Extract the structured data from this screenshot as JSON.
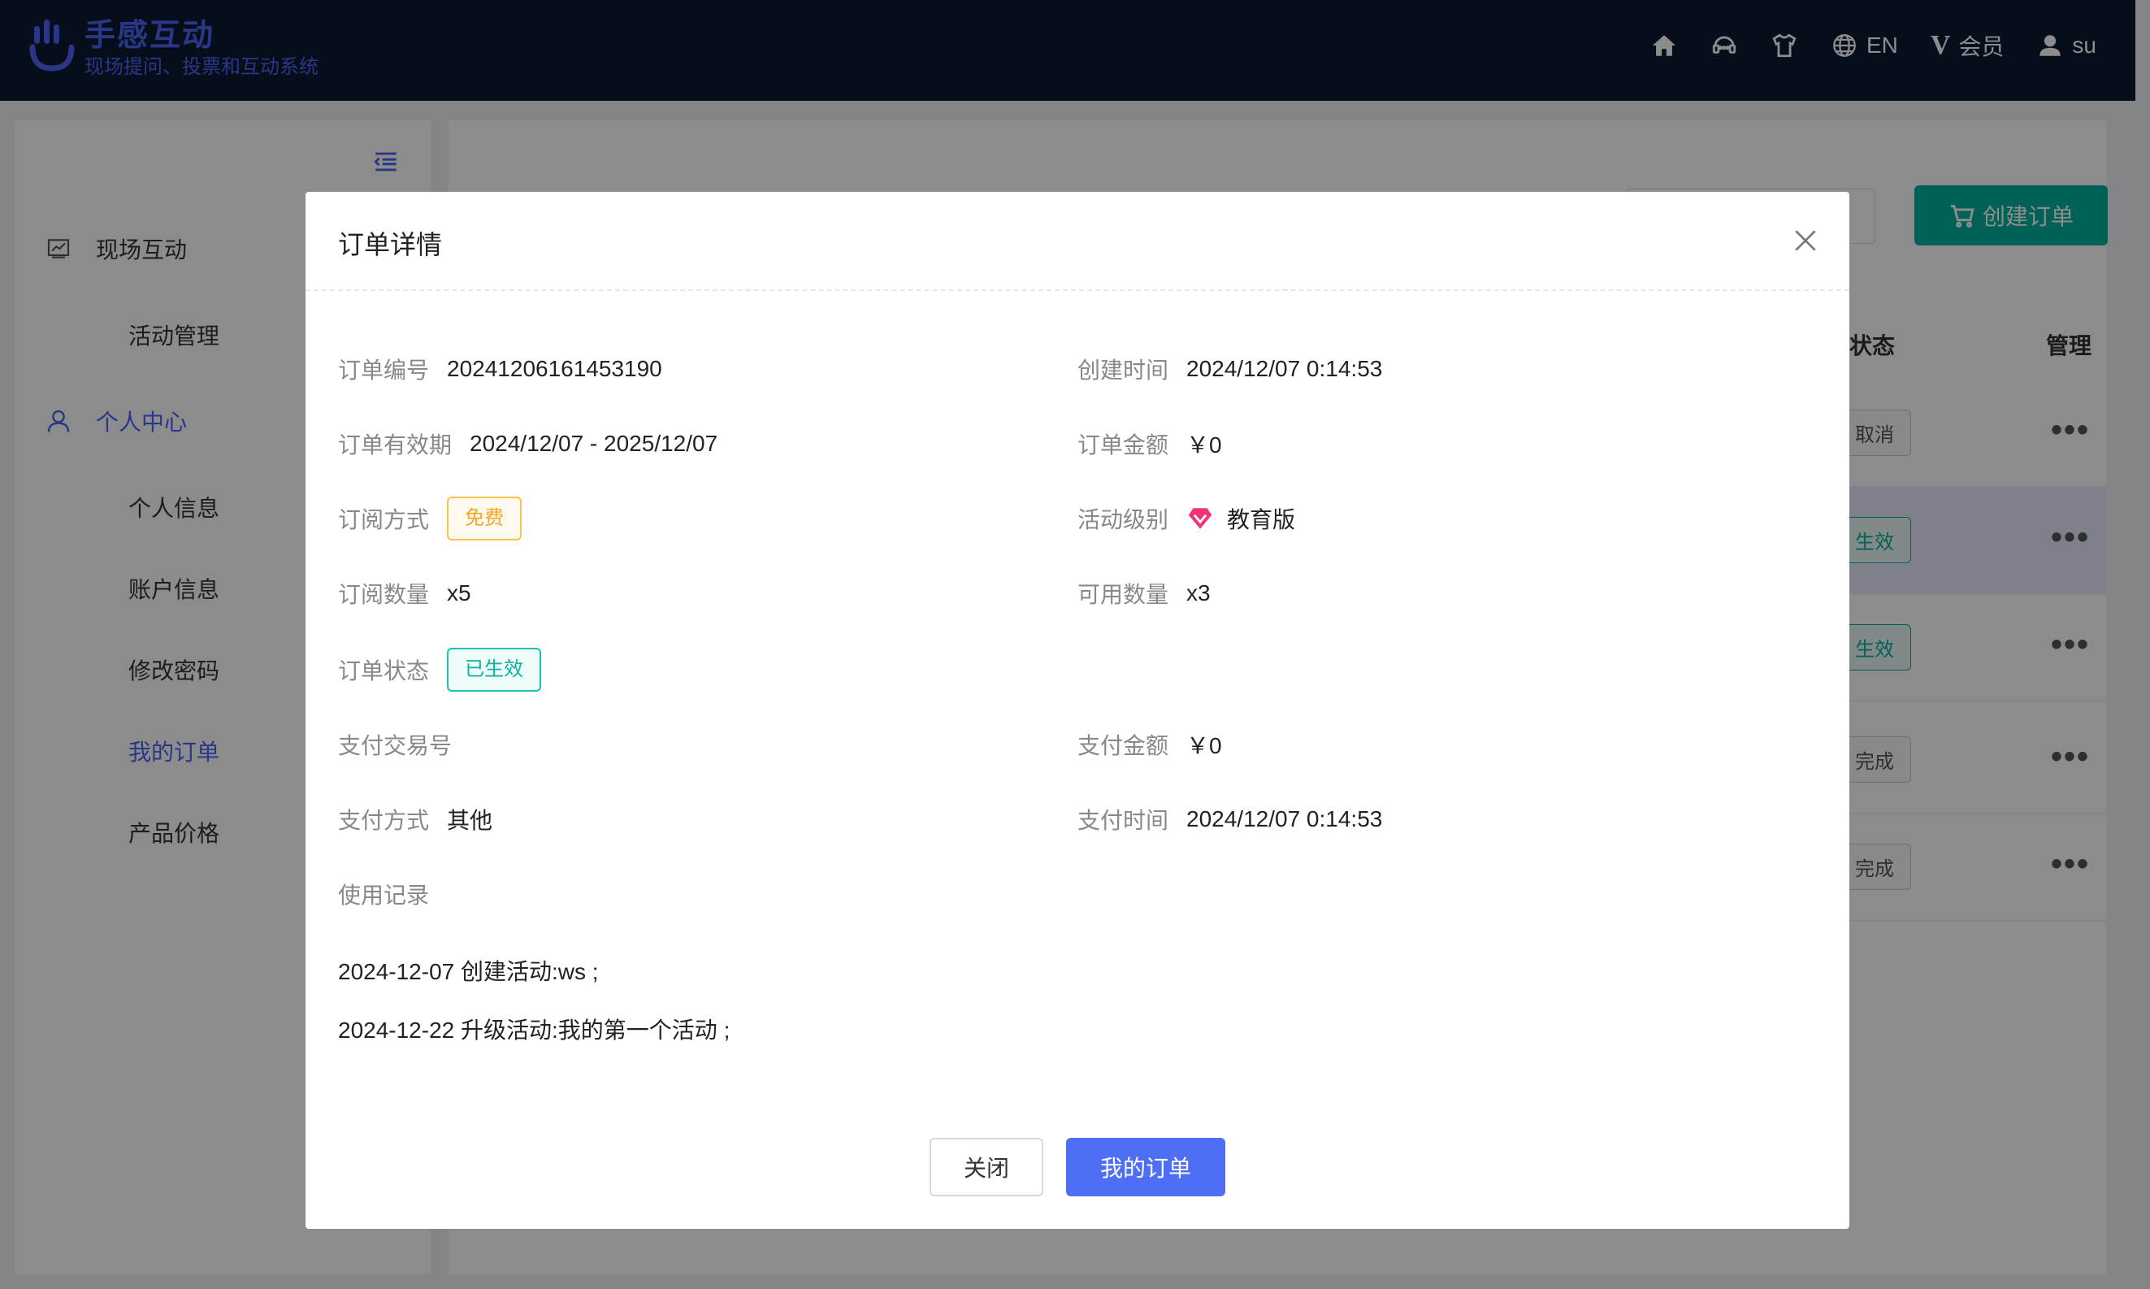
{
  "header": {
    "brand_title": "手感互动",
    "brand_subtitle": "现场提问、投票和互动系统",
    "lang_label": "EN",
    "vip_mark": "V",
    "vip_label": "会员",
    "user_label": "su",
    "icons": [
      "home-icon",
      "chat-icon",
      "shirt-icon",
      "globe-icon",
      "user-icon"
    ]
  },
  "sidebar": {
    "items": [
      {
        "label": "现场互动",
        "icon": "chart-icon"
      },
      {
        "label": "活动管理"
      },
      {
        "label": "个人中心",
        "icon": "user-icon",
        "active": true
      },
      {
        "label": "个人信息"
      },
      {
        "label": "账户信息"
      },
      {
        "label": "修改密码"
      },
      {
        "label": "我的订单",
        "active": true
      },
      {
        "label": "产品价格"
      }
    ]
  },
  "main": {
    "create_order_label": "创建订单",
    "columns": {
      "status": "状态",
      "manage": "管理"
    },
    "rows": [
      {
        "status": "取消"
      },
      {
        "status": "生效"
      },
      {
        "status": "生效"
      },
      {
        "status": "完成"
      },
      {
        "status": "完成"
      }
    ],
    "more_label": "•••"
  },
  "modal": {
    "title": "订单详情",
    "order_no_label": "订单编号",
    "order_no": "20241206161453190",
    "created_label": "创建时间",
    "created": "2024/12/07 0:14:53",
    "validity_label": "订单有效期",
    "validity": "2024/12/07 - 2025/12/07",
    "amount_label": "订单金额",
    "amount": "￥0",
    "sub_mode_label": "订阅方式",
    "sub_mode": "免费",
    "level_label": "活动级别",
    "level": "教育版",
    "sub_qty_label": "订阅数量",
    "sub_qty": "x5",
    "avail_qty_label": "可用数量",
    "avail_qty": "x3",
    "status_label": "订单状态",
    "status": "已生效",
    "pay_txn_label": "支付交易号",
    "pay_amount_label": "支付金额",
    "pay_amount": "￥0",
    "pay_method_label": "支付方式",
    "pay_method": "其他",
    "pay_time_label": "支付时间",
    "pay_time": "2024/12/07 0:14:53",
    "usage_label": "使用记录",
    "usage_log": [
      "2024-12-07 创建活动:ws ;",
      "2024-12-22 升级活动:我的第一个活动 ;"
    ],
    "close_label": "关闭",
    "my_orders_label": "我的订单"
  },
  "colors": {
    "brand": "#4d63f5",
    "header_bg": "#0c1a33",
    "accent_teal": "#00b39f",
    "primary_button": "#4d6ef5",
    "free_tag": "#f5a623",
    "level_icon": "#f0347a"
  }
}
